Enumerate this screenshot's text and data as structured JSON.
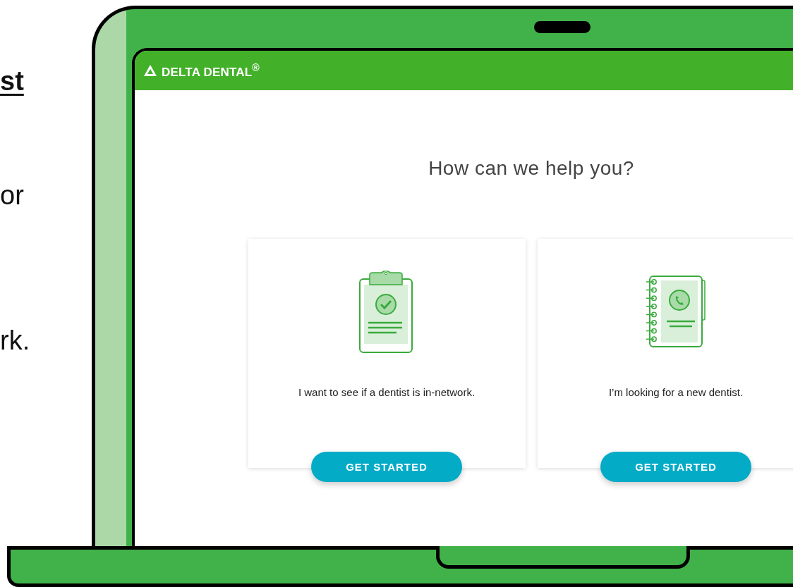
{
  "slide_text": [
    {
      "text": "st",
      "kind": "heading"
    },
    {
      "text": "or",
      "kind": "body"
    },
    {
      "text": "rk.",
      "kind": "body"
    }
  ],
  "site": {
    "logo": "DELTA DENTAL$^{®}$",
    "heading": "How can we help you?"
  },
  "cards": [
    {
      "kind": "clipboard",
      "text": "I want to see if a dentist is in-network.",
      "button": "GET STARTED"
    },
    {
      "kind": "notebook",
      "text": "I’m looking for a new dentist.",
      "button": "GET STARTED"
    }
  ]
}
